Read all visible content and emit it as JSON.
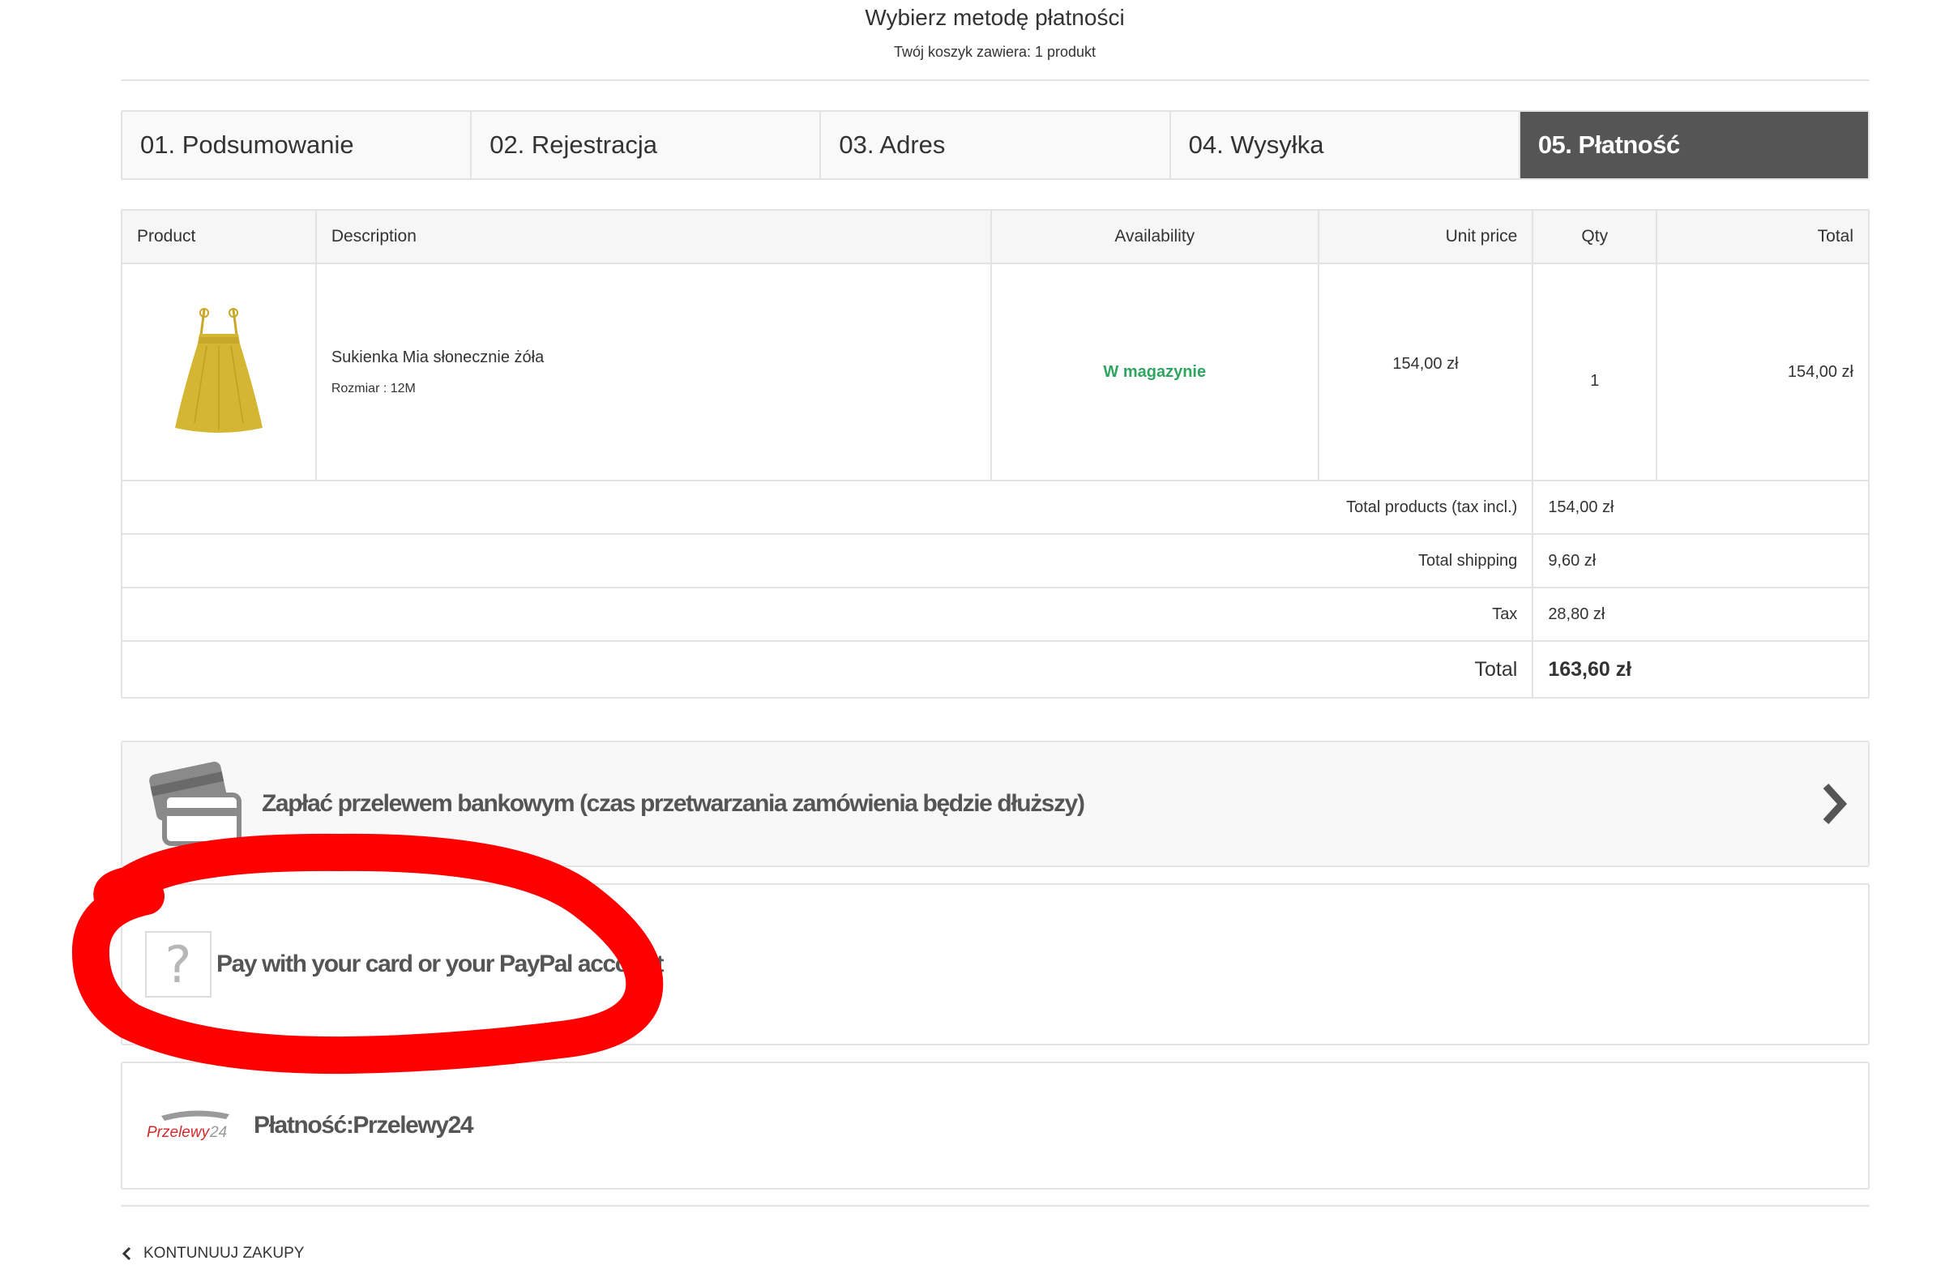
{
  "header": {
    "title": "Wybierz metodę płatności",
    "cart_count": "Twój koszyk zawiera: 1 produkt"
  },
  "steps": [
    {
      "label": "01. Podsumowanie",
      "active": false
    },
    {
      "label": "02. Rejestracja",
      "active": false
    },
    {
      "label": "03. Adres",
      "active": false
    },
    {
      "label": "04. Wysyłka",
      "active": false
    },
    {
      "label": "05. Płatność",
      "active": true
    }
  ],
  "table": {
    "headers": {
      "product": "Product",
      "description": "Description",
      "availability": "Availability",
      "unit_price": "Unit price",
      "qty": "Qty",
      "total": "Total"
    },
    "item": {
      "image_icon": "yellow-dress-image",
      "name": "Sukienka Mia słonecznie żóła",
      "attribute": "Rozmiar : 12M",
      "availability": "W magazynie",
      "unit_price": "154,00 zł",
      "qty": "1",
      "total": "154,00 zł"
    },
    "summary": {
      "products_label": "Total products (tax incl.)",
      "products_value": "154,00 zł",
      "shipping_label": "Total shipping",
      "shipping_value": "9,60 zł",
      "tax_label": "Tax",
      "tax_value": "28,80 zł",
      "total_label": "Total",
      "total_value": "163,60 zł"
    }
  },
  "payment_methods": {
    "bank": {
      "label": "Zapłać przelewem bankowym (czas przetwarzania zamówienia będzie dłuższy)",
      "icon": "bank-card-icon"
    },
    "paypal": {
      "label": "Pay with your card or your PayPal account",
      "icon": "missing-image-icon"
    },
    "przelewy24": {
      "label": "Płatność:Przelewy24",
      "logo_text": "Przelewy24"
    }
  },
  "footer": {
    "continue_label": "KONTUNUUJ ZAKUPY"
  },
  "colors": {
    "active_step_bg": "#555555",
    "availability_green": "#2fa561",
    "annotation_red": "#ff0000"
  }
}
